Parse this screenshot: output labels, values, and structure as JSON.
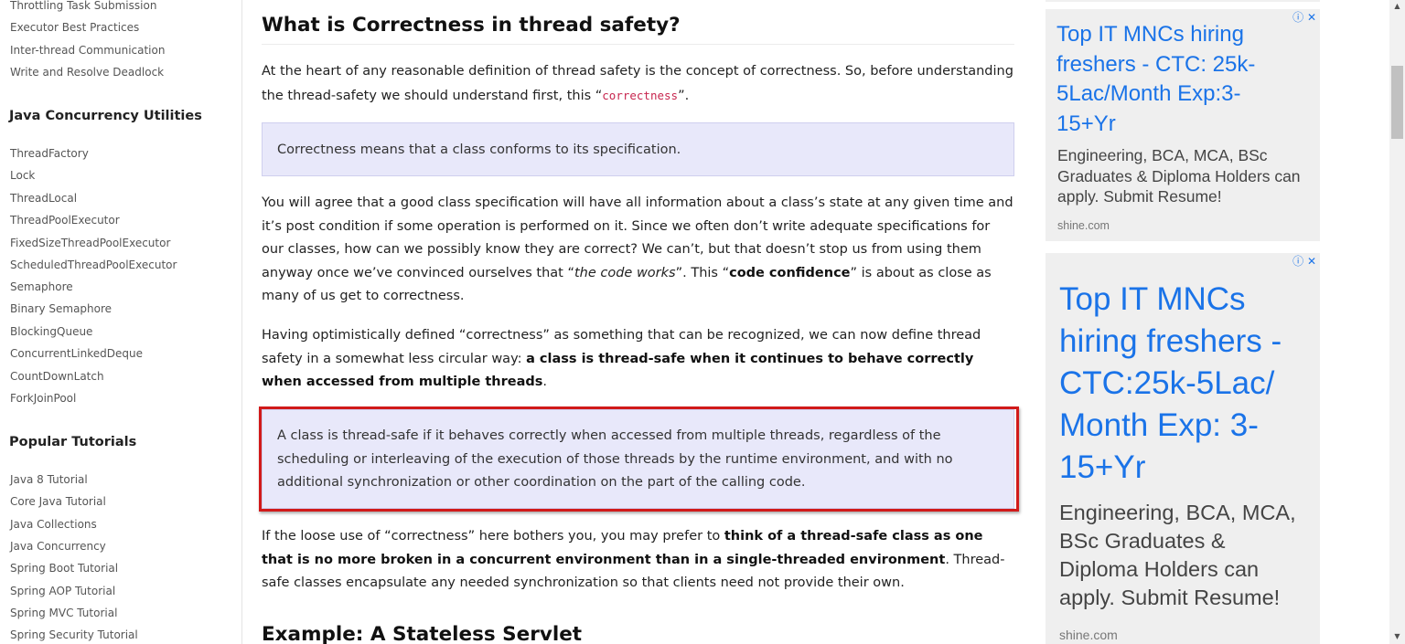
{
  "sidebar": {
    "group1_links": [
      "Throttling Task Submission",
      "Executor Best Practices",
      "Inter-thread Communication",
      "Write and Resolve Deadlock"
    ],
    "heading_utilities": "Java Concurrency Utilities",
    "utilities_links": [
      "ThreadFactory",
      "Lock",
      "ThreadLocal",
      "ThreadPoolExecutor",
      "FixedSizeThreadPoolExecutor",
      "ScheduledThreadPoolExecutor",
      "Semaphore",
      "Binary Semaphore",
      "BlockingQueue",
      "ConcurrentLinkedDeque",
      "CountDownLatch",
      "ForkJoinPool"
    ],
    "heading_popular": "Popular Tutorials",
    "popular_links": [
      "Java 8 Tutorial",
      "Core Java Tutorial",
      "Java Collections",
      "Java Concurrency",
      "Spring Boot Tutorial",
      "Spring AOP Tutorial",
      "Spring MVC Tutorial",
      "Spring Security Tutorial"
    ]
  },
  "article": {
    "heading": "What is Correctness in thread safety?",
    "p1_text": "At the heart of any reasonable definition of thread safety is the concept of correctness. So, before understanding the thread-safety we should understand first, this “",
    "p1_code": "correctness",
    "p1_end": "”.",
    "quote1": "Correctness means that a class conforms to its specification.",
    "p2_a": "You will agree that a good class specification will have all information about a class’s state at any given time and it’s post condition if some operation is performed on it. Since we often don’t write adequate specifications for our classes, how can we possibly know they are correct? We can’t, but that doesn’t stop us from using them anyway once we’ve convinced ourselves that “",
    "p2_em": "the code works",
    "p2_b": "”. This “",
    "p2_bold": "code confidence",
    "p2_end": "” is about as close as many of us get to correctness.",
    "p3_a": "Having optimistically defined “correctness” as something that can be recognized, we can now define thread safety in a somewhat less circular way: ",
    "p3_bold": "a class is thread-safe when it continues to behave correctly when accessed from multiple threads",
    "p3_end": ".",
    "quote2": "A class is thread-safe if it behaves correctly when accessed from multiple threads, regardless of the scheduling or interleaving of the execution of those threads by the runtime environment, and with no additional synchronization or other coordination on the part of the calling code.",
    "p4_a": "If the loose use of “correctness” here bothers you, you may prefer to ",
    "p4_bold": "think of a thread-safe class as one that is no more broken in a concurrent environment than in a single-threaded environment",
    "p4_end": ". Thread-safe classes encapsulate any needed synchronization so that clients need not provide their own.",
    "heading2": "Example: A Stateless Servlet"
  },
  "ads": [
    {
      "title": "Top IT MNCs hiring freshers - CTC: 25k-5Lac/Month Exp:3-15+Yr",
      "body": "Engineering, BCA, MCA, BSc Graduates & Diploma Holders can apply. Submit Resume!",
      "source": "shine.com",
      "info_icon": "ⓘ",
      "close_icon": "✕"
    },
    {
      "title": "Top IT MNCs hiring freshers - CTC:25k-5Lac/ Month Exp: 3-15+Yr",
      "body": "Engineering, BCA, MCA, BSc Graduates & Diploma Holders can apply. Submit Resume!",
      "source": "shine.com",
      "info_icon": "ⓘ",
      "close_icon": "✕"
    }
  ],
  "scrollbar": {
    "up_icon": "▲",
    "down_icon": "▼"
  },
  "colors": {
    "quote_background": "#e8e8fa",
    "highlight_border": "#d11a1a",
    "ad_link": "#1a73e8",
    "code_text": "#c7254e"
  }
}
